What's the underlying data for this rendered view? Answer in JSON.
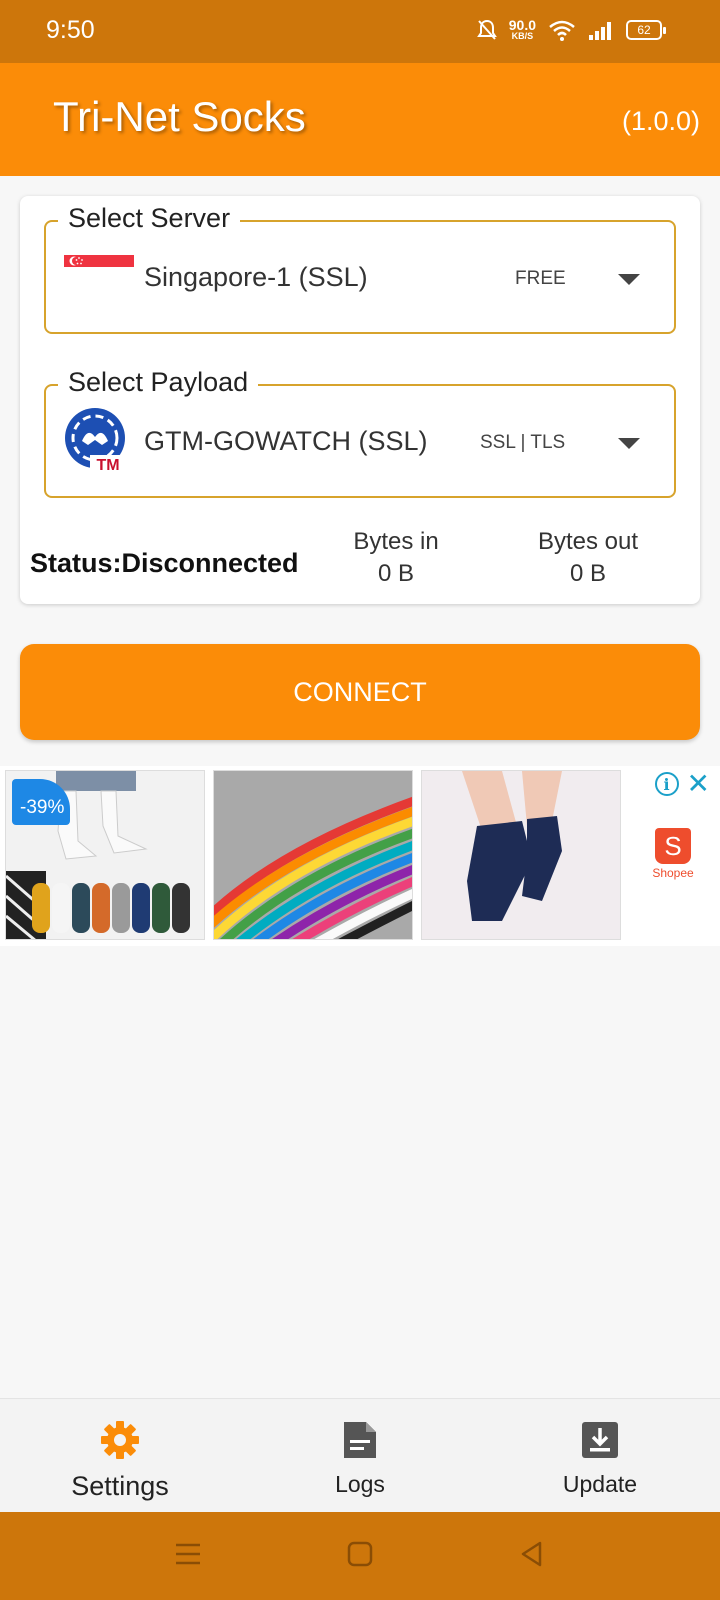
{
  "status_bar": {
    "time": "9:50",
    "net_speed_value": "90.0",
    "net_speed_unit": "KB/S",
    "battery": "62"
  },
  "app_bar": {
    "title": "Tri-Net Socks",
    "version": "(1.0.0)"
  },
  "server": {
    "legend": "Select Server",
    "value": "Singapore-1 (SSL)",
    "tag": "FREE",
    "flag_icon": "singapore-flag-icon"
  },
  "payload": {
    "legend": "Select Payload",
    "value": "GTM-GOWATCH (SSL)",
    "tag": "SSL | TLS",
    "logo_text": "TM"
  },
  "status": {
    "text": "Status:Disconnected",
    "bytes_in_label": "Bytes in",
    "bytes_in_value": "0 B",
    "bytes_out_label": "Bytes out",
    "bytes_out_value": "0 B"
  },
  "connect_label": "CONNECT",
  "ad": {
    "discount": "-39%",
    "brand": "Shopee",
    "brand_letter": "S",
    "info_glyph": "i",
    "close_glyph": "✕"
  },
  "bottom_nav": {
    "settings": "Settings",
    "logs": "Logs",
    "update": "Update"
  },
  "colors": {
    "primary": "#fb8c08",
    "status_bar": "#cd760b",
    "field_border": "#d7a32c"
  }
}
